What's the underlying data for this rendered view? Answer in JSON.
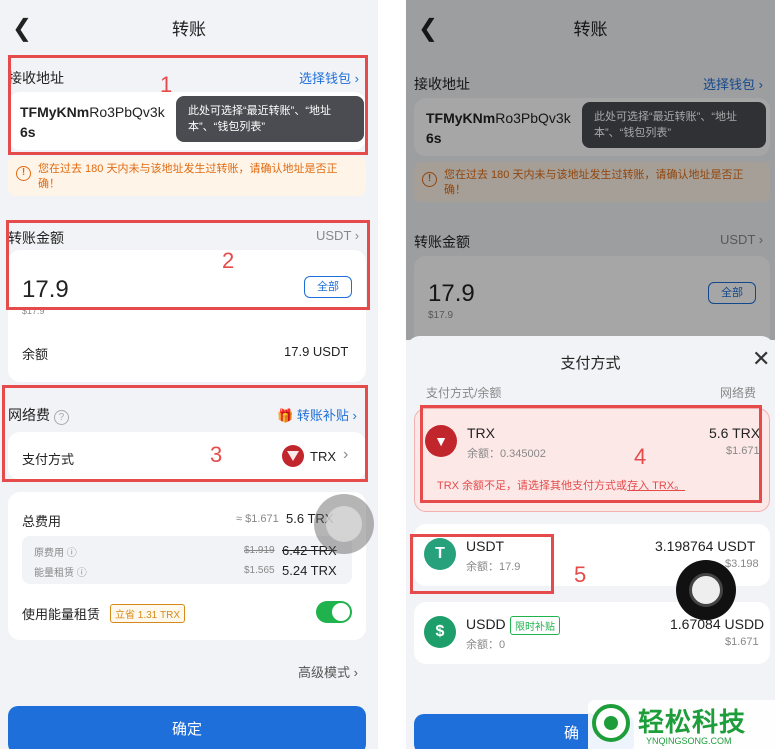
{
  "left": {
    "title": "转账",
    "receive_label": "接收地址",
    "choose_wallet": "选择钱包",
    "address_bold": "TFMyKNm",
    "address_rest": "Ro3PbQv3k",
    "address_line2": "6s",
    "tooltip": "此处可选择“最近转账”、“地址本”、“钱包列表”",
    "warning": "您在过去 180 天内未与该地址发生过转账，请确认地址是否正确！",
    "amount_label": "转账金额",
    "currency": "USDT",
    "amount": "17.9",
    "amount_usd": "$17.9",
    "all_btn": "全部",
    "balance_label": "余额",
    "balance_value": "17.9 USDT",
    "fee_label": "网络费",
    "subsidy_link": "转账补贴",
    "pay_method_label": "支付方式",
    "pay_method_value": "TRX",
    "total_fee_label": "总费用",
    "total_fee_usd": "≈ $1.671",
    "total_fee_value": "5.6 TRX",
    "orig_fee_label": "原费用",
    "orig_fee_usd": "$1.919",
    "orig_fee_value": "6.42 TRX",
    "energy_label": "能量租赁",
    "energy_usd": "$1.565",
    "energy_value": "5.24 TRX",
    "use_energy_label": "使用能量租赁",
    "save_badge": "立省 1.31 TRX",
    "advanced": "高级模式",
    "confirm": "确定",
    "markers": [
      "1",
      "2",
      "3"
    ]
  },
  "right": {
    "title": "转账",
    "receive_label": "接收地址",
    "choose_wallet": "选择钱包",
    "address_bold": "TFMyKNm",
    "address_rest": "Ro3PbQv3k",
    "address_line2": "6s",
    "tooltip": "此处可选择“最近转账”、“地址本”、“钱包列表”",
    "warning": "您在过去 180 天内未与该地址发生过转账，请确认地址是否正确！",
    "amount_label": "转账金额",
    "currency": "USDT",
    "amount": "17.9",
    "amount_usd": "$17.9",
    "all_btn": "全部",
    "sheet_title": "支付方式",
    "col_left": "支付方式/余额",
    "col_right": "网络费",
    "options": [
      {
        "name": "TRX",
        "balance": "余额：0.345002",
        "fee": "5.6 TRX",
        "fee_usd": "$1.671"
      },
      {
        "name": "USDT",
        "balance": "余额：17.9",
        "fee": "3.198764 USDT",
        "fee_usd": "$3.198"
      },
      {
        "name": "USDD",
        "badge": "限时补贴",
        "balance": "余额：0",
        "fee": "1.67084 USDD",
        "fee_usd": "$1.671"
      }
    ],
    "trx_error": "TRX 余额不足，请选择其他支付方式或",
    "trx_error_link": "存入 TRX。",
    "confirm": "确",
    "markers": [
      "4",
      "5"
    ]
  },
  "watermark": {
    "cn": "轻松科技",
    "en": "YNQINGSONG.COM"
  },
  "colors": {
    "accent": "#1e6fd9",
    "annotation": "#e54b4b",
    "warning": "#e06b12",
    "toggle_on": "#1fb24d",
    "trx": "#c2262d",
    "usdt": "#26a17b",
    "usdd": "#1e9e6a"
  }
}
